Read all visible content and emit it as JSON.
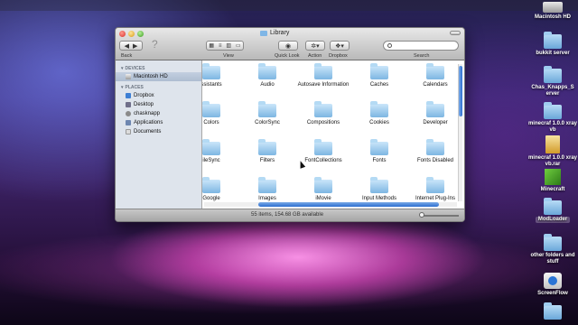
{
  "desktop": {
    "icons": [
      {
        "label": "Macintosh HD",
        "icon": "hard-drive-icon"
      },
      {
        "label": "bukkit server",
        "icon": "folder-icon"
      },
      {
        "label": "Chas_Knapps_S erver",
        "icon": "folder-icon"
      },
      {
        "label": "minecraf 1.0.0 xray vb",
        "icon": "folder-icon"
      },
      {
        "label": "minecraf 1.0.0 xray vb.rar",
        "icon": "archive-icon"
      },
      {
        "label": "Minecraft",
        "icon": "minecraft-icon"
      },
      {
        "label": "ModLoader",
        "icon": "folder-icon"
      },
      {
        "label": "other folders and stuff",
        "icon": "folder-icon"
      },
      {
        "label": "ScreenFlow",
        "icon": "app-icon"
      },
      {
        "label": "",
        "icon": "folder-icon"
      }
    ]
  },
  "window": {
    "title": "Library",
    "toolbar": {
      "back_label": "Back",
      "view_label": "View",
      "quicklook_label": "Quick Look",
      "action_label": "Action",
      "dropbox_label": "Dropbox",
      "search_label": "Search",
      "search_placeholder": ""
    },
    "sidebar": {
      "devices_header": "DEVICES",
      "devices": [
        "Macintosh HD"
      ],
      "places_header": "PLACES",
      "places": [
        "Dropbox",
        "Desktop",
        "chasknapp",
        "Applications",
        "Documents"
      ]
    },
    "items": [
      "ssistants",
      "Audio",
      "Autosave Information",
      "Caches",
      "Calendars",
      "Colors",
      "ColorSync",
      "Compositions",
      "Cookies",
      "Developer",
      "ileSync",
      "Filters",
      "FontCollections",
      "Fonts",
      "Fonts Disabled",
      "Google",
      "Images",
      "iMovie",
      "Input Methods",
      "Internet Plug-Ins"
    ],
    "status": "55 items, 154.68 GB available"
  },
  "colors": {
    "accent": "#2c6fd1",
    "folder": "#7db6e2"
  }
}
